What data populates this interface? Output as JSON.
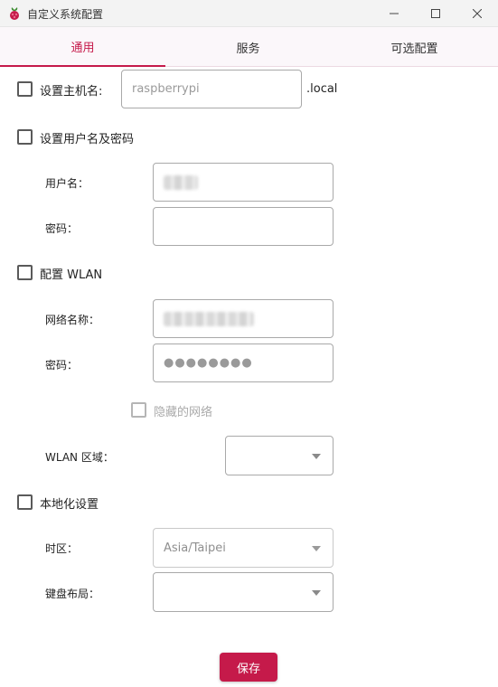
{
  "window": {
    "title": "自定义系统配置"
  },
  "tabs": [
    {
      "label": "通用",
      "active": true
    },
    {
      "label": "服务",
      "active": false
    },
    {
      "label": "可选配置",
      "active": false
    }
  ],
  "hostname": {
    "checkbox_label": "设置主机名:",
    "placeholder": "raspberrypi",
    "suffix": ".local"
  },
  "user": {
    "checkbox_label": "设置用户名及密码",
    "username_label": "用户名：",
    "password_label": "密码："
  },
  "wlan": {
    "checkbox_label": "配置 WLAN",
    "ssid_label": "网络名称：",
    "password_label": "密码：",
    "password_value": "●●●●●●●●",
    "hidden_label": "隐藏的网络",
    "country_label": "WLAN 区域："
  },
  "locale": {
    "checkbox_label": "本地化设置",
    "timezone_label": "时区：",
    "timezone_value": "Asia/Taipei",
    "keyboard_label": "键盘布局："
  },
  "actions": {
    "save_label": "保存"
  },
  "colors": {
    "accent": "#c51a4a"
  }
}
